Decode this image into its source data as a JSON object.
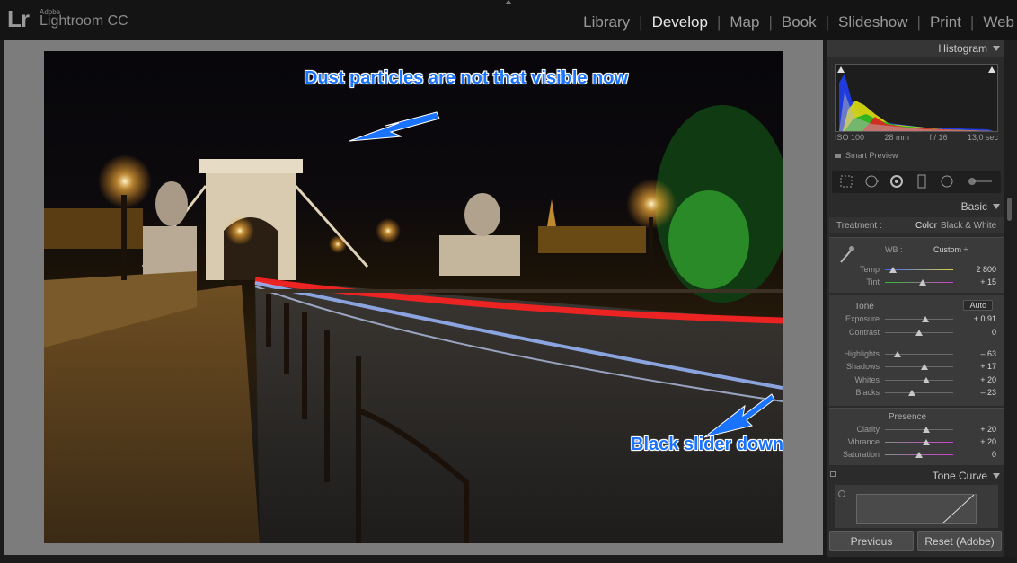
{
  "brand": {
    "small": "Adobe",
    "name": "Lightroom CC",
    "logo": "Lr"
  },
  "modules": [
    {
      "label": "Library",
      "active": false
    },
    {
      "label": "Develop",
      "active": true
    },
    {
      "label": "Map",
      "active": false
    },
    {
      "label": "Book",
      "active": false
    },
    {
      "label": "Slideshow",
      "active": false
    },
    {
      "label": "Print",
      "active": false
    },
    {
      "label": "Web",
      "active": false
    }
  ],
  "annotations": {
    "dust": "Dust particles are not that visible now",
    "blacks": "Black slider down",
    "color": "#1a73ff"
  },
  "histogram": {
    "title": "Histogram",
    "iso": "ISO 100",
    "focal": "28 mm",
    "aperture": "f / 16",
    "shutter": "13,0 sec",
    "smart_preview": "Smart Preview"
  },
  "basic": {
    "title": "Basic",
    "treatment_label": "Treatment :",
    "treatment_color": "Color",
    "treatment_bw": "Black & White",
    "wb_label": "WB :",
    "wb_value": "Custom ÷",
    "temp": {
      "label": "Temp",
      "value": "2 800",
      "pos": 0.12
    },
    "tint": {
      "label": "Tint",
      "value": "+ 15",
      "pos": 0.55
    },
    "tone_title": "Tone",
    "auto": "Auto",
    "exposure": {
      "label": "Exposure",
      "value": "+ 0,91",
      "pos": 0.59
    },
    "contrast": {
      "label": "Contrast",
      "value": "0",
      "pos": 0.5
    },
    "highlights": {
      "label": "Highlights",
      "value": "– 63",
      "pos": 0.19
    },
    "shadows": {
      "label": "Shadows",
      "value": "+ 17",
      "pos": 0.58
    },
    "whites": {
      "label": "Whites",
      "value": "+ 20",
      "pos": 0.6
    },
    "blacks": {
      "label": "Blacks",
      "value": "– 23",
      "pos": 0.39
    },
    "presence_title": "Presence",
    "clarity": {
      "label": "Clarity",
      "value": "+ 20",
      "pos": 0.6
    },
    "vibrance": {
      "label": "Vibrance",
      "value": "+ 20",
      "pos": 0.6
    },
    "saturation": {
      "label": "Saturation",
      "value": "0",
      "pos": 0.5
    }
  },
  "tone_curve": {
    "title": "Tone Curve"
  },
  "buttons": {
    "previous": "Previous",
    "reset": "Reset (Adobe)"
  }
}
